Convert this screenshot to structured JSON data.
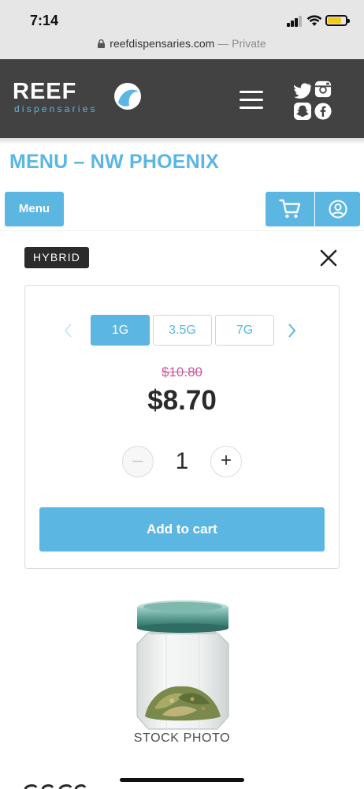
{
  "status_bar": {
    "time": "7:14",
    "battery_level": 0.75
  },
  "browser": {
    "domain": "reefdispensaries.com",
    "mode": "Private",
    "separator": "—"
  },
  "header": {
    "logo_wordmark": "REEF",
    "logo_subtitle": "dispensaries",
    "social_icons": [
      "twitter-icon",
      "instagram-icon",
      "snapchat-icon",
      "facebook-icon"
    ]
  },
  "page": {
    "title": "MENU – NW PHOENIX"
  },
  "toolbar": {
    "menu_label": "Menu",
    "cart_icon": "cart-icon",
    "account_icon": "account-icon"
  },
  "product": {
    "strain_type": "HYBRID",
    "weights": [
      {
        "label": "1G",
        "selected": true
      },
      {
        "label": "3.5G",
        "selected": false
      },
      {
        "label": "7G",
        "selected": false
      }
    ],
    "old_price": "$10.80",
    "price": "$8.70",
    "quantity": "1",
    "add_to_cart_label": "Add to cart",
    "photo_caption": "STOCK PHOTO"
  },
  "colors": {
    "accent": "#5bb6e2",
    "header_bg": "#424242",
    "strike_price": "#c85a9c",
    "badge_bg": "#2b2b2b"
  }
}
